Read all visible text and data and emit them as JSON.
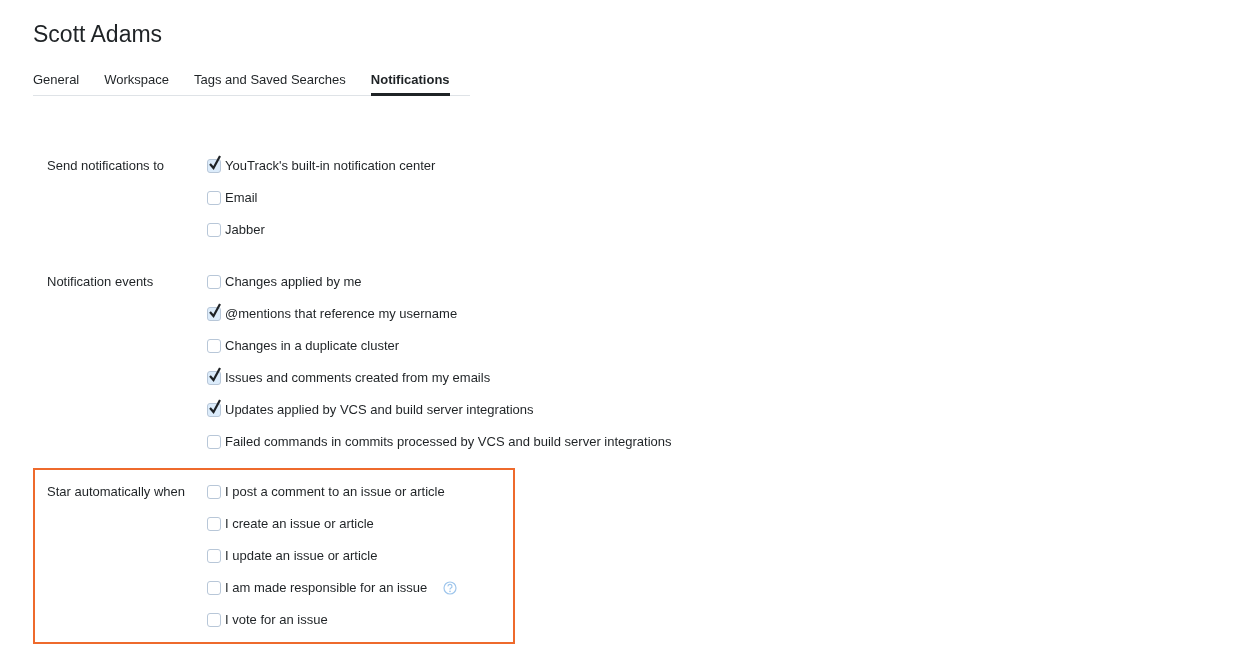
{
  "title": "Scott Adams",
  "tabs": [
    {
      "label": "General",
      "selected": false
    },
    {
      "label": "Workspace",
      "selected": false
    },
    {
      "label": "Tags and Saved Searches",
      "selected": false
    },
    {
      "label": "Notifications",
      "selected": true
    }
  ],
  "sections": [
    {
      "label": "Send notifications to",
      "highlighted": false,
      "options": [
        {
          "label": "YouTrack's built-in notification center",
          "checked": true,
          "help": false
        },
        {
          "label": "Email",
          "checked": false,
          "help": false
        },
        {
          "label": "Jabber",
          "checked": false,
          "help": false
        }
      ]
    },
    {
      "label": "Notification events",
      "highlighted": false,
      "options": [
        {
          "label": "Changes applied by me",
          "checked": false,
          "help": false
        },
        {
          "label": "@mentions that reference my username",
          "checked": true,
          "help": false
        },
        {
          "label": "Changes in a duplicate cluster",
          "checked": false,
          "help": false
        },
        {
          "label": "Issues and comments created from my emails",
          "checked": true,
          "help": false
        },
        {
          "label": "Updates applied by VCS and build server integrations",
          "checked": true,
          "help": false
        },
        {
          "label": "Failed commands in commits processed by VCS and build server integrations",
          "checked": false,
          "help": false
        }
      ]
    },
    {
      "label": "Star automatically when",
      "highlighted": true,
      "options": [
        {
          "label": "I post a comment to an issue or article",
          "checked": false,
          "help": false
        },
        {
          "label": "I create an issue or article",
          "checked": false,
          "help": false
        },
        {
          "label": "I update an issue or article",
          "checked": false,
          "help": false
        },
        {
          "label": "I am made responsible for an issue",
          "checked": false,
          "help": true
        },
        {
          "label": "I vote for an issue",
          "checked": false,
          "help": false
        }
      ]
    }
  ]
}
